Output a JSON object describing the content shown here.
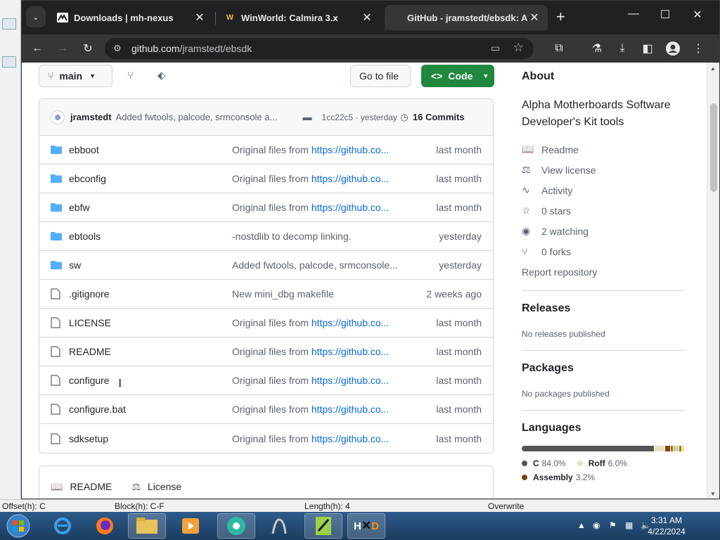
{
  "browser": {
    "tabs": [
      {
        "title": "Downloads | mh-nexus",
        "active": false
      },
      {
        "title": "WinWorld: Calmira 3.x",
        "active": false
      },
      {
        "title": "GitHub - jramstedt/ebsdk: Alp",
        "active": true
      }
    ],
    "url_host": "github.com",
    "url_path": "/jramstedt/ebsdk"
  },
  "repo": {
    "branch": "main",
    "go_to_file": "Go to file",
    "code_button": "Code",
    "commit": {
      "author": "jramstedt",
      "message": "Added fwtools, palcode, srmconsole a...",
      "hash_time": "1cc22c5 · yesterday",
      "commits": "16 Commits"
    },
    "files": [
      {
        "name": "ebboot",
        "type": "folder",
        "msg": "Original files from ",
        "link": "https://github.co...",
        "date": "last month"
      },
      {
        "name": "ebconfig",
        "type": "folder",
        "msg": "Original files from ",
        "link": "https://github.co...",
        "date": "last month"
      },
      {
        "name": "ebfw",
        "type": "folder",
        "msg": "Original files from ",
        "link": "https://github.co...",
        "date": "last month"
      },
      {
        "name": "ebtools",
        "type": "folder",
        "msg": "-nostdlib to decomp linking.",
        "link": "",
        "date": "yesterday"
      },
      {
        "name": "sw",
        "type": "folder",
        "msg": "Added fwtools, palcode, srmconsole...",
        "link": "",
        "date": "yesterday"
      },
      {
        "name": ".gitignore",
        "type": "file",
        "msg": "New mini_dbg makefile",
        "link": "",
        "date": "2 weeks ago"
      },
      {
        "name": "LICENSE",
        "type": "file",
        "msg": "Original files from ",
        "link": "https://github.co...",
        "date": "last month"
      },
      {
        "name": "README",
        "type": "file",
        "msg": "Original files from ",
        "link": "https://github.co...",
        "date": "last month"
      },
      {
        "name": "configure",
        "type": "file",
        "msg": "Original files from ",
        "link": "https://github.co...",
        "date": "last month"
      },
      {
        "name": "configure.bat",
        "type": "file",
        "msg": "Original files from ",
        "link": "https://github.co...",
        "date": "last month"
      },
      {
        "name": "sdksetup",
        "type": "file",
        "msg": "Original files from ",
        "link": "https://github.co...",
        "date": "last month"
      }
    ],
    "readme_tab": "README",
    "license_tab": "License"
  },
  "about": {
    "heading": "About",
    "description": "Alpha Motherboards Software Developer's Kit tools",
    "links": [
      {
        "icon": "book-icon",
        "label": "Readme"
      },
      {
        "icon": "scale-icon",
        "label": "View license"
      },
      {
        "icon": "pulse-icon",
        "label": "Activity"
      },
      {
        "icon": "star-icon",
        "label": "0 stars"
      },
      {
        "icon": "eye-icon",
        "label": "2 watching"
      },
      {
        "icon": "fork-icon",
        "label": "0 forks"
      }
    ],
    "report": "Report repository",
    "releases_heading": "Releases",
    "releases_text": "No releases published",
    "packages_heading": "Packages",
    "packages_text": "No packages published",
    "languages_heading": "Languages",
    "languages": [
      {
        "name": "C",
        "pct": "84.0%",
        "share": 84.0,
        "color": "#555555"
      },
      {
        "name": "Roff",
        "pct": "6.0%",
        "share": 6.0,
        "color": "#ecdebe"
      },
      {
        "name": "Assembly",
        "pct": "3.2%",
        "share": 3.2,
        "color": "#6e4c13"
      }
    ],
    "languages_other_colors": [
      "#e34c26",
      "#89e051",
      "#c4c4c4",
      "#b07219",
      "#f1e05a"
    ]
  },
  "statusbar": {
    "offset": "Offset(h): C",
    "block": "Block(h): C-F",
    "length": "Length(h): 4",
    "mode": "Overwrite"
  },
  "clock": {
    "time": "3:31 AM",
    "date": "4/22/2024"
  }
}
